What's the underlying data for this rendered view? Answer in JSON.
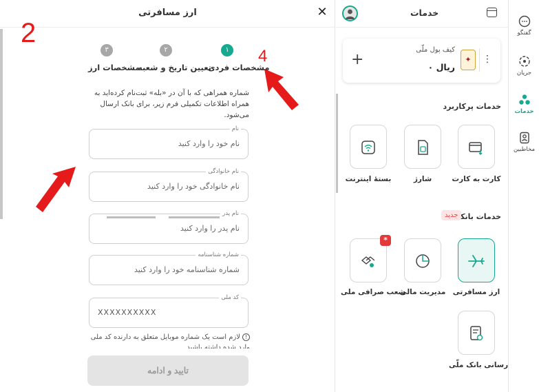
{
  "left_panel": {
    "title": "ارز مسافرتی",
    "close_icon": "close-icon",
    "annotation_left": "2",
    "annotation_right": "4",
    "steps": [
      {
        "number": "۱",
        "label": "مشخصات فردی",
        "active": true
      },
      {
        "number": "۲",
        "label": "تعیین تاریخ و شعبه",
        "active": false
      },
      {
        "number": "۳",
        "label": "مشخصات ارز",
        "active": false
      }
    ],
    "intro_text": "شماره همراهی که با آن در «بله» ثبت‌نام کرده‌اید به همراه اطلاعات تکمیلی فرم زیر، برای بانک ارسال می‌شود.",
    "fields": {
      "first_name": {
        "label": "نام",
        "placeholder": "نام خود را وارد کنید"
      },
      "last_name": {
        "label": "نام خانوادگی",
        "placeholder": "نام خانوادگی خود را وارد کنید"
      },
      "father_name": {
        "label": "نام پدر",
        "placeholder": "نام پدر را وارد کنید"
      },
      "id_number": {
        "label": "شماره شناسنامه",
        "placeholder": "شماره شناسنامه خود را وارد کنید"
      },
      "national_code": {
        "label": "کد ملی",
        "value": "XXXXXXXXXX"
      }
    },
    "hint_text": "لازم است یک شماره موبایل متعلق به دارنده کد ملی وارد شده داشته باشید",
    "confirm_button": "تایید و ادامه"
  },
  "middle_panel": {
    "title": "خدمات",
    "wallet": {
      "label": "کیف پول ملّی",
      "balance": "۰ ریال",
      "logo_icon": "bank-melli-logo",
      "more_icon": "more-vertical-icon",
      "add_icon": "plus-icon"
    },
    "popular_section_title": "خدمات پرکاربرد",
    "popular_services": [
      {
        "label": "کارت به کارت",
        "icon": "card-transfer-icon"
      },
      {
        "label": "شارژ",
        "icon": "sim-card-icon"
      },
      {
        "label": "بستهٔ اینترنت",
        "icon": "wifi-icon"
      }
    ],
    "banking_section_title": "خدمات بانکی",
    "new_badge": "جدید",
    "banking_services": [
      {
        "label": "ارز مسافرتی",
        "icon": "airplane-icon",
        "active": true
      },
      {
        "label": "مدیریت مالی",
        "icon": "pie-chart-icon"
      },
      {
        "label": "شعب صرافی ملی",
        "icon": "exchange-branch-icon",
        "badge": "*"
      },
      {
        "label": "اطلاع‌رسانی بانک ملّی",
        "icon": "notification-doc-icon"
      }
    ]
  },
  "rail": {
    "items": [
      {
        "label": "گفتگو",
        "icon": "chat-icon"
      },
      {
        "label": "جریان",
        "icon": "stream-icon"
      },
      {
        "label": "خدمات",
        "icon": "services-icon",
        "active": true
      },
      {
        "label": "مخاطبین",
        "icon": "contacts-icon"
      }
    ]
  },
  "colors": {
    "accent": "#17a890",
    "annotation": "#e51a1a",
    "badge": "#e23a3a"
  }
}
